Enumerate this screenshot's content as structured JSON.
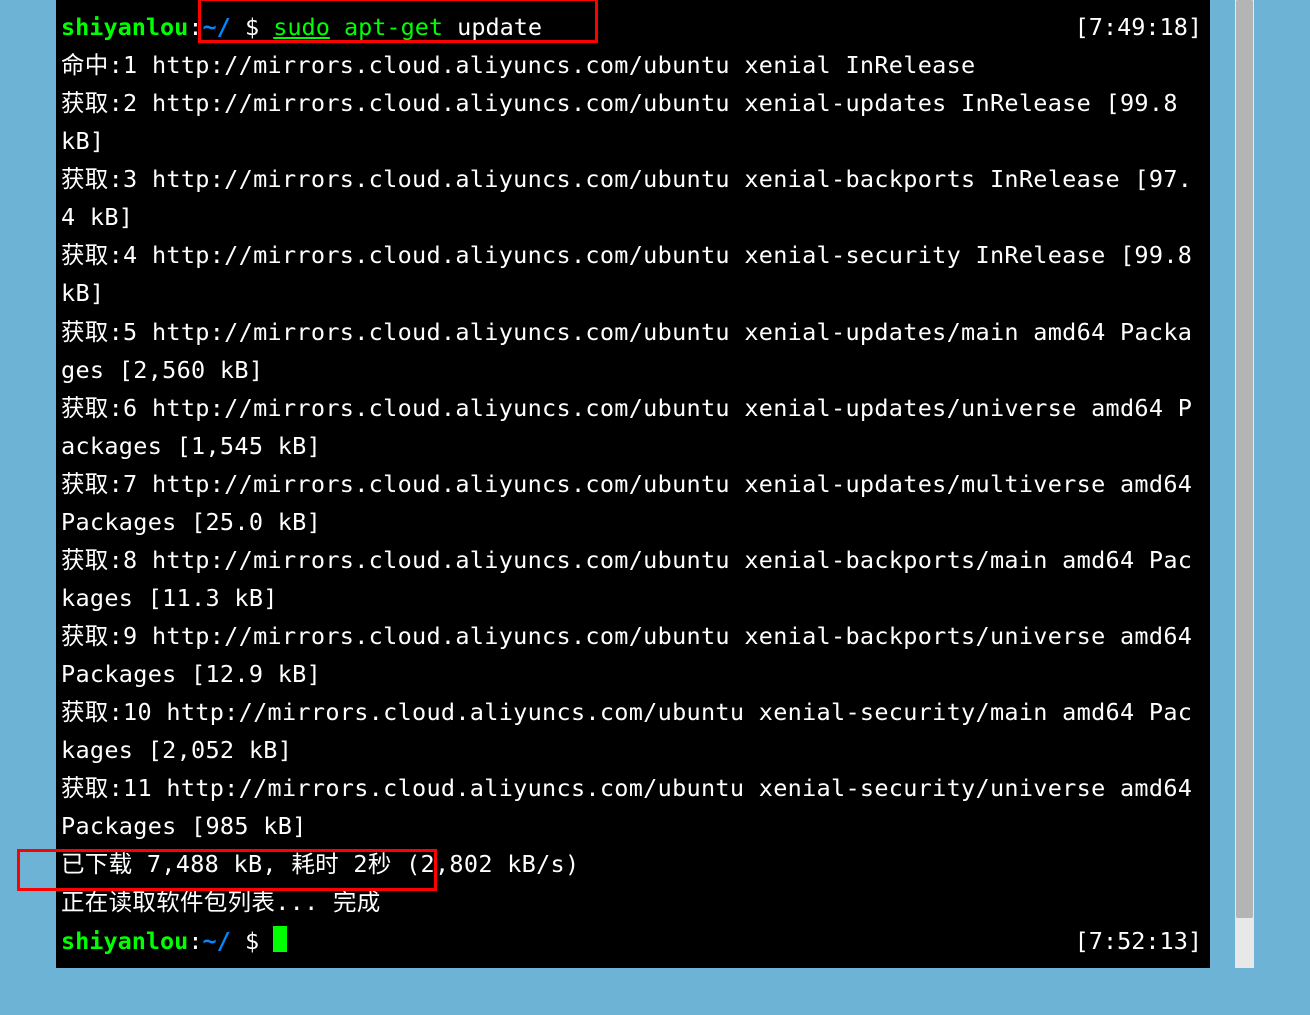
{
  "prompt1": {
    "user": "shiyanlou",
    "sep": ":",
    "path": "~/",
    "dollar": " $ ",
    "cmd_sudo": "sudo",
    "cmd_apt": " apt-get",
    "cmd_arg": " update",
    "timestamp": "[7:49:18]"
  },
  "output_lines": [
    "命中:1 http://mirrors.cloud.aliyuncs.com/ubuntu xenial InRelease",
    "获取:2 http://mirrors.cloud.aliyuncs.com/ubuntu xenial-updates InRelease [99.8 kB]",
    "获取:3 http://mirrors.cloud.aliyuncs.com/ubuntu xenial-backports InRelease [97.4 kB]",
    "获取:4 http://mirrors.cloud.aliyuncs.com/ubuntu xenial-security InRelease [99.8 kB]",
    "获取:5 http://mirrors.cloud.aliyuncs.com/ubuntu xenial-updates/main amd64 Packages [2,560 kB]",
    "获取:6 http://mirrors.cloud.aliyuncs.com/ubuntu xenial-updates/universe amd64 Packages [1,545 kB]",
    "获取:7 http://mirrors.cloud.aliyuncs.com/ubuntu xenial-updates/multiverse amd64 Packages [25.0 kB]",
    "获取:8 http://mirrors.cloud.aliyuncs.com/ubuntu xenial-backports/main amd64 Packages [11.3 kB]",
    "获取:9 http://mirrors.cloud.aliyuncs.com/ubuntu xenial-backports/universe amd64 Packages [12.9 kB]",
    "获取:10 http://mirrors.cloud.aliyuncs.com/ubuntu xenial-security/main amd64 Packages [2,052 kB]",
    "获取:11 http://mirrors.cloud.aliyuncs.com/ubuntu xenial-security/universe amd64 Packages [985 kB]",
    "已下载 7,488 kB, 耗时 2秒 (2,802 kB/s)",
    "正在读取软件包列表... 完成"
  ],
  "prompt2": {
    "user": "shiyanlou",
    "sep": ":",
    "path": "~/",
    "dollar": " $ ",
    "timestamp": "[7:52:13]"
  }
}
